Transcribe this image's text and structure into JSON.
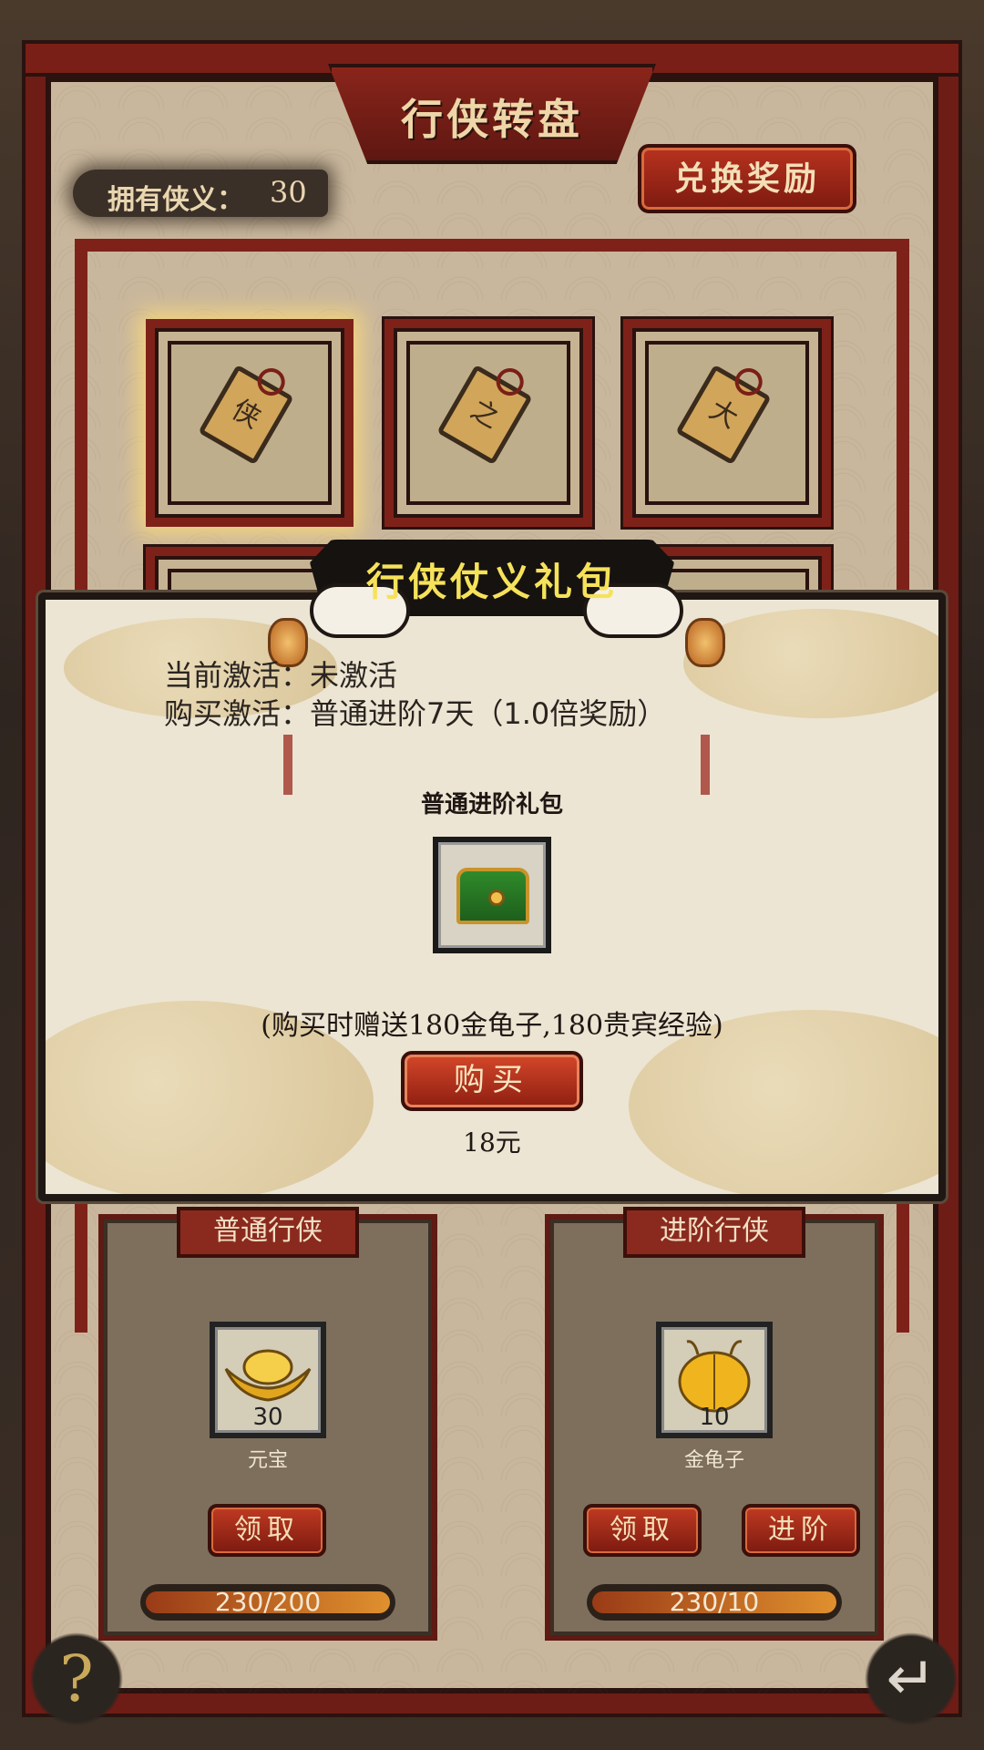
{
  "header": {
    "title": "行侠转盘"
  },
  "currency": {
    "label": "拥有侠义：",
    "value": "30"
  },
  "exchange_button": "兑换奖励",
  "cards": [
    {
      "glyph": "侠",
      "selected": true
    },
    {
      "glyph": "之",
      "selected": false
    },
    {
      "glyph": "大",
      "selected": false
    }
  ],
  "modal": {
    "title": "行侠仗义礼包",
    "status_line": "当前激活：未激活",
    "purchase_line": "购买激活：普通进阶7天（1.0倍奖励）",
    "pack_name": "普通进阶礼包",
    "gift_note": "(购买时赠送180金龟子,180贵宾经验)",
    "buy_button": "购买",
    "price": "18元"
  },
  "panels": [
    {
      "title": "普通行侠",
      "reward_qty": "30",
      "reward_name": "元宝",
      "buttons": [
        "领取"
      ],
      "progress_text": "230/200",
      "progress_fill": 1.0
    },
    {
      "title": "进阶行侠",
      "reward_qty": "10",
      "reward_name": "金龟子",
      "buttons": [
        "领取",
        "进阶"
      ],
      "progress_text": "230/10",
      "progress_fill": 1.0
    }
  ],
  "corner": {
    "help_glyph": "?",
    "back_glyph": "↵"
  },
  "colors": {
    "frame_red": "#7e2219",
    "title_yellow": "#f6e25a",
    "button_red": "#b8321f"
  }
}
